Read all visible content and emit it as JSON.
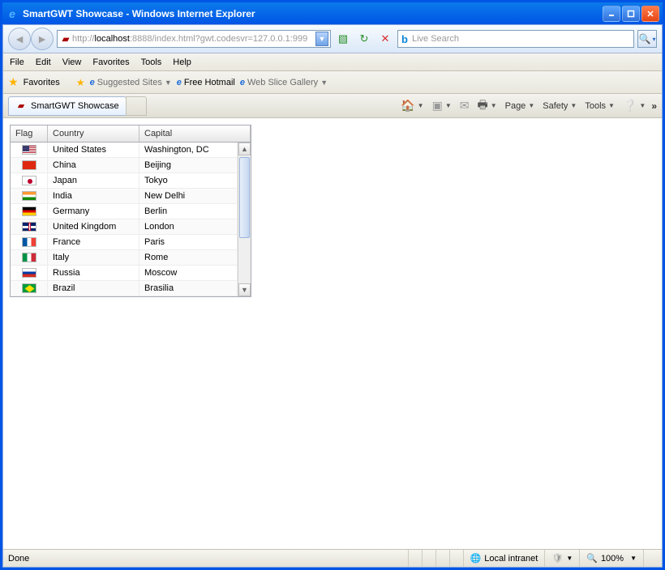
{
  "window": {
    "title": "SmartGWT Showcase - Windows Internet Explorer"
  },
  "nav": {
    "url_gray_pre": "http://",
    "url_host": "localhost",
    "url_gray_post": ":8888/index.html?gwt.codesvr=127.0.0.1:999",
    "search_placeholder": "Live Search"
  },
  "menus": {
    "file": "File",
    "edit": "Edit",
    "view": "View",
    "favorites": "Favorites",
    "tools": "Tools",
    "help": "Help"
  },
  "favbar": {
    "favorites": "Favorites",
    "suggested": "Suggested Sites",
    "hotmail": "Free Hotmail",
    "webslice": "Web Slice Gallery"
  },
  "tab": {
    "title": "SmartGWT Showcase"
  },
  "cmd": {
    "page": "Page",
    "safety": "Safety",
    "tools": "Tools"
  },
  "grid": {
    "headers": {
      "flag": "Flag",
      "country": "Country",
      "capital": "Capital"
    },
    "rows": [
      {
        "flag": "us",
        "country": "United States",
        "capital": "Washington, DC"
      },
      {
        "flag": "cn",
        "country": "China",
        "capital": "Beijing"
      },
      {
        "flag": "jp",
        "country": "Japan",
        "capital": "Tokyo"
      },
      {
        "flag": "in",
        "country": "India",
        "capital": "New Delhi"
      },
      {
        "flag": "de",
        "country": "Germany",
        "capital": "Berlin"
      },
      {
        "flag": "uk",
        "country": "United Kingdom",
        "capital": "London"
      },
      {
        "flag": "fr",
        "country": "France",
        "capital": "Paris"
      },
      {
        "flag": "it",
        "country": "Italy",
        "capital": "Rome"
      },
      {
        "flag": "ru",
        "country": "Russia",
        "capital": "Moscow"
      },
      {
        "flag": "br",
        "country": "Brazil",
        "capital": "Brasilia"
      }
    ]
  },
  "status": {
    "done": "Done",
    "zone": "Local intranet",
    "zoom": "100%"
  }
}
